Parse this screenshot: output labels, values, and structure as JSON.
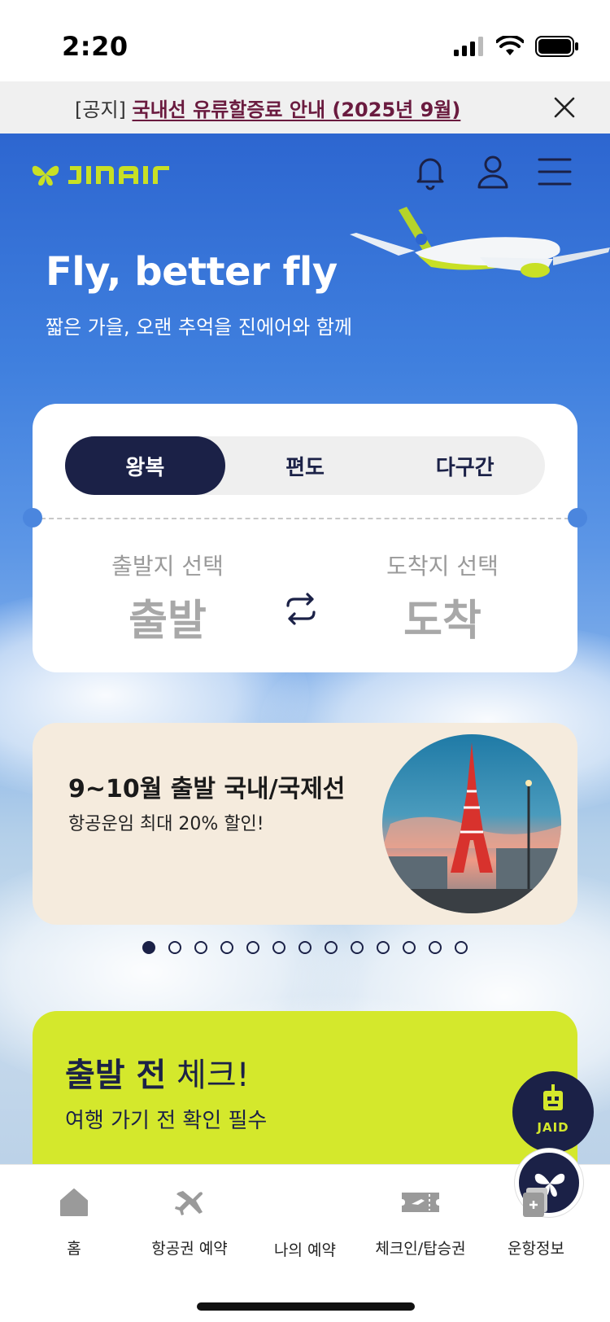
{
  "status": {
    "time": "2:20"
  },
  "notice": {
    "prefix": "[공지] ",
    "link": "국내선 유류할증료 안내 (2025년 9월)"
  },
  "header": {
    "logo_alt": "JINAIR"
  },
  "hero": {
    "title": "Fly, better fly",
    "subtitle": "짧은 가을, 오랜 추억을 진에어와 함께"
  },
  "booking": {
    "tabs": [
      "왕복",
      "편도",
      "다구간"
    ],
    "active_tab": "왕복",
    "departure": {
      "label": "출발지 선택",
      "value": "출발"
    },
    "arrival": {
      "label": "도착지 선택",
      "value": "도착"
    }
  },
  "promo": {
    "title": "9~10월 출발 국내/국제선",
    "subtitle": "항공운임 최대 20% 할인!",
    "slide_count": 13,
    "active_slide": 1
  },
  "check": {
    "title_bold": "출발 전",
    "title_rest": " 체크!",
    "subtitle": "여행 가기 전 확인 필수"
  },
  "jaid": {
    "label": "JAID"
  },
  "tabbar": {
    "items": [
      {
        "label": "홈",
        "icon": "home-icon"
      },
      {
        "label": "항공권 예약",
        "icon": "airplane-icon"
      },
      {
        "label": "나의 예약",
        "icon": "butterfly-icon"
      },
      {
        "label": "체크인/탑승권",
        "icon": "ticket-icon"
      },
      {
        "label": "운항정보",
        "icon": "flight-info-icon"
      }
    ]
  },
  "colors": {
    "navy": "#1b2147",
    "lime": "#d4e82c",
    "sky": "#3f7fde",
    "promo_bg": "#f5ebdd"
  }
}
